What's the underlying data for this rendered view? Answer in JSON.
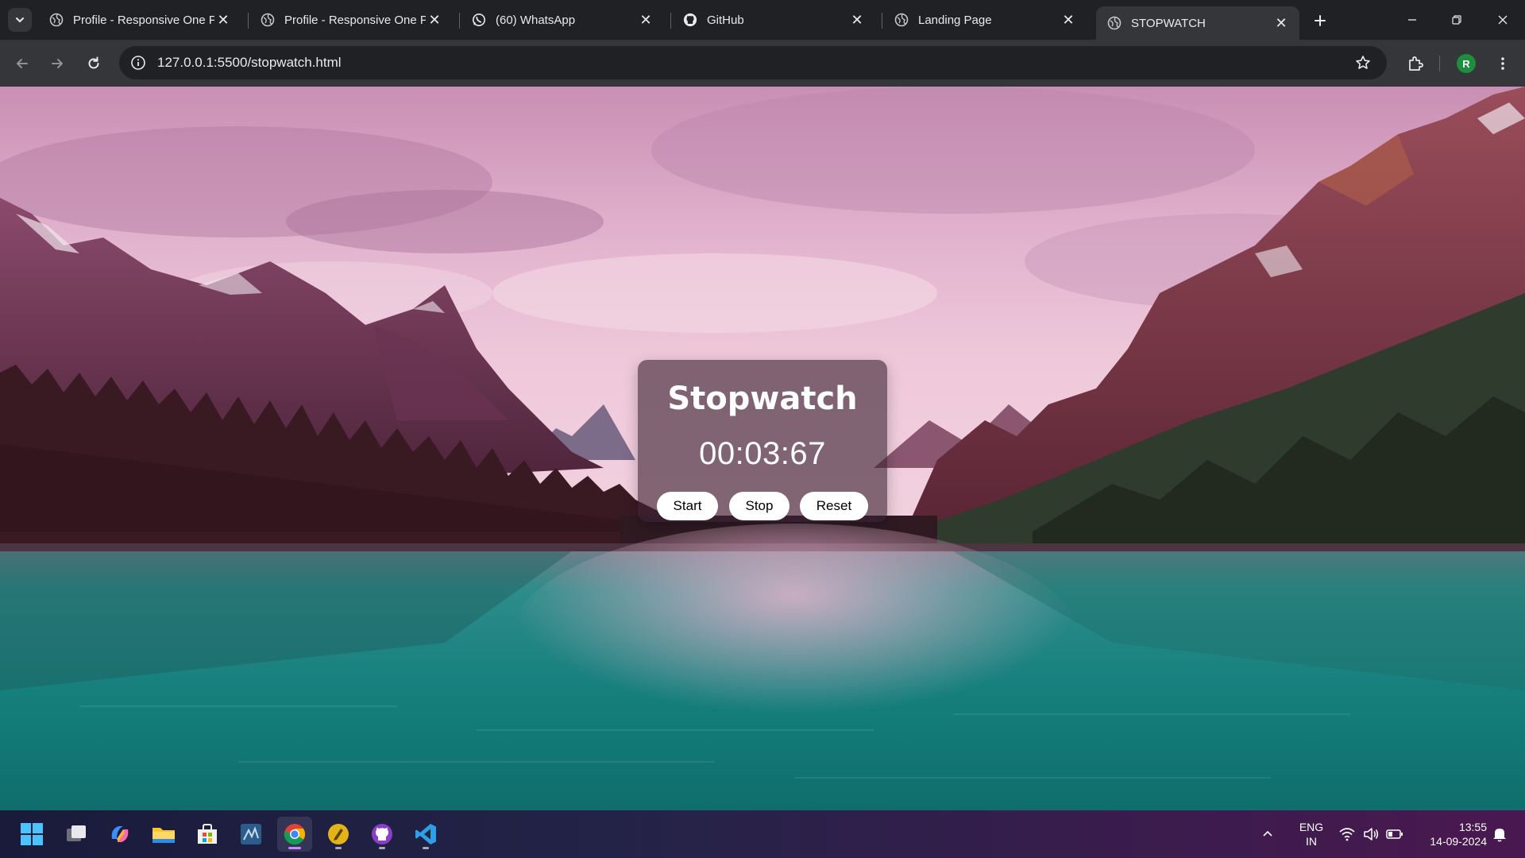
{
  "browser": {
    "tabs": [
      {
        "title": "Profile - Responsive One P",
        "icon": "globe-icon",
        "active": false
      },
      {
        "title": "Profile - Responsive One P",
        "icon": "globe-icon",
        "active": false
      },
      {
        "title": "(60) WhatsApp",
        "icon": "whatsapp-icon",
        "active": false
      },
      {
        "title": "GitHub",
        "icon": "github-icon",
        "active": false
      },
      {
        "title": "Landing Page",
        "icon": "globe-icon",
        "active": false
      },
      {
        "title": "STOPWATCH",
        "icon": "globe-icon",
        "active": true
      }
    ],
    "address_bar": {
      "url": "127.0.0.1:5500/stopwatch.html"
    },
    "profile_initial": "R"
  },
  "page": {
    "title": "Stopwatch",
    "time": "00:03:67",
    "buttons": {
      "start": "Start",
      "stop": "Stop",
      "reset": "Reset"
    }
  },
  "taskbar": {
    "apps": [
      "windows-start-icon",
      "task-view-icon",
      "copilot-icon",
      "file-explorer-icon",
      "microsoft-store-icon",
      "mysql-workbench-icon",
      "chrome-icon",
      "notes-app-icon",
      "github-desktop-icon",
      "vscode-icon"
    ],
    "active_app": "chrome-icon",
    "language": {
      "line1": "ENG",
      "line2": "IN"
    },
    "clock": {
      "time": "13:55",
      "date": "14-09-2024"
    }
  },
  "colors": {
    "tab_strip": "#202124",
    "toolbar": "#35363a",
    "card_overlay": "#3c2332",
    "button_bg": "#ffffff",
    "profile_avatar": "#1e8e3e"
  }
}
